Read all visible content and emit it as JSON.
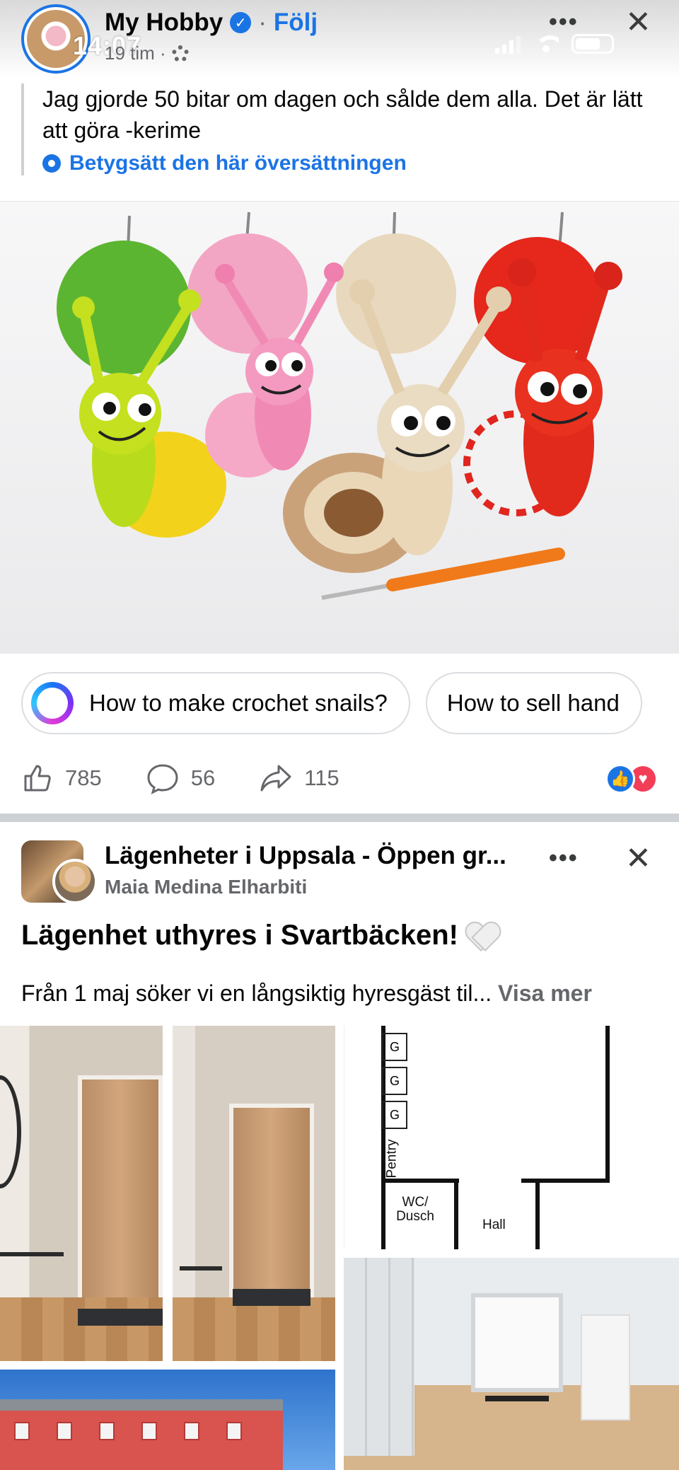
{
  "status_bar": {
    "time": "14:07"
  },
  "post1": {
    "page_name": "My Hobby",
    "separator": "·",
    "follow_label": "Följ",
    "time_ago": "19 tim ·",
    "text": "Jag gjorde 50 bitar om dagen och sålde dem alla. Det är lätt att göra -kerime",
    "rate_translation_label": "Betygsätt den här översättningen",
    "ask_chips": [
      "How to make crochet snails?",
      "How to sell hand"
    ],
    "likes": "785",
    "comments": "56",
    "shares": "115",
    "reactions": [
      "like-icon",
      "love-icon"
    ]
  },
  "post2": {
    "group_name": "Lägenheter i Uppsala - Öppen gr...",
    "author": "Maia Medina Elharbiti",
    "title": "Lägenhet uthyres i Svartbäcken!",
    "snippet": "Från 1 maj söker vi en långsiktig hyresgäst til...",
    "see_more_label": "Visa mer",
    "floorplan": {
      "g_labels": [
        "G",
        "G",
        "G"
      ],
      "pentry_label": "Pentry",
      "wc_label": "WC/ Dusch",
      "hall_label": "Hall"
    }
  },
  "colors": {
    "facebook_blue": "#1b74e4",
    "secondary_text": "#65676b",
    "love_red": "#f33e58"
  }
}
